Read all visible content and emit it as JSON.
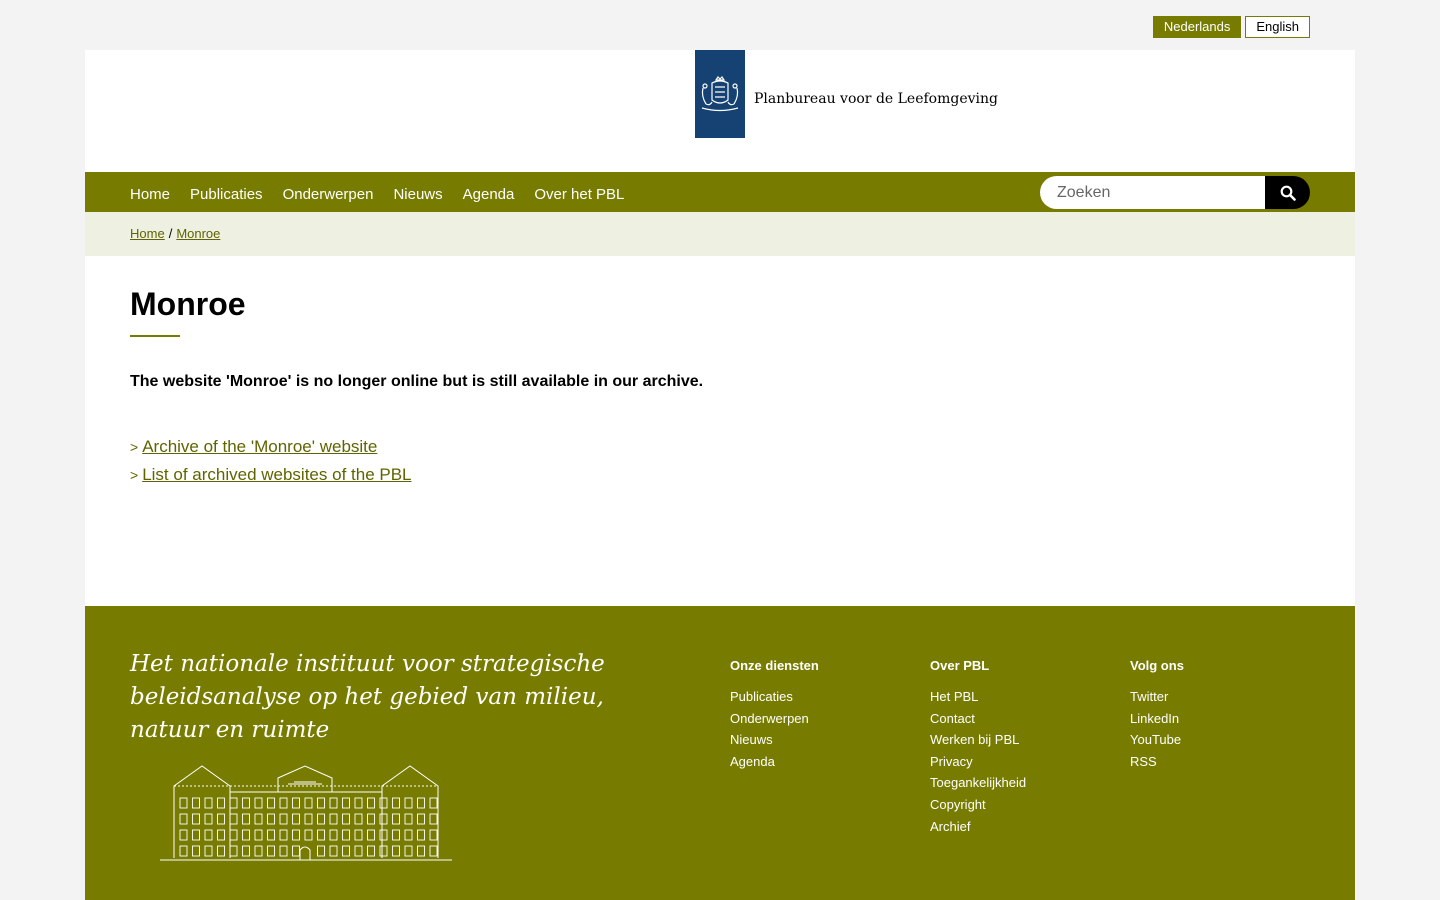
{
  "lang": {
    "nl": "Nederlands",
    "en": "English"
  },
  "header": {
    "org_name": "Planbureau voor de Leefomgeving"
  },
  "nav": {
    "items": [
      {
        "label": "Home"
      },
      {
        "label": "Publicaties"
      },
      {
        "label": "Onderwerpen"
      },
      {
        "label": "Nieuws"
      },
      {
        "label": "Agenda"
      },
      {
        "label": "Over het PBL"
      }
    ],
    "search_placeholder": "Zoeken"
  },
  "breadcrumb": {
    "home": "Home",
    "separator": "/",
    "current": "Monroe"
  },
  "main": {
    "title": "Monroe",
    "notice": "The website 'Monroe' is no longer online but is still available in our archive.",
    "links": [
      {
        "chevron": ">",
        "label": "Archive of the 'Monroe' website"
      },
      {
        "chevron": ">",
        "label": "List of archived websites of the PBL"
      }
    ]
  },
  "footer": {
    "tagline": "Het nationale instituut voor strategische beleidsanalyse op het gebied van milieu, natuur en ruimte",
    "columns": [
      {
        "heading": "Onze diensten",
        "items": [
          "Publicaties",
          "Onderwerpen",
          "Nieuws",
          "Agenda"
        ]
      },
      {
        "heading": "Over PBL",
        "items": [
          "Het PBL",
          "Contact",
          "Werken bij PBL",
          "Privacy",
          "Toegankelijkheid",
          "Copyright",
          "Archief"
        ]
      },
      {
        "heading": "Volg ons",
        "items": [
          "Twitter",
          "LinkedIn",
          "YouTube",
          "RSS"
        ]
      }
    ]
  },
  "colors": {
    "olive": "#777c00",
    "olive_link": "#5f6400",
    "logo_blue": "#154273",
    "breadcrumb_bg": "#eef0e1",
    "outer_bg": "#f3f3f3"
  },
  "icons": {
    "search": "search-icon",
    "coat_of_arms": "coat-of-arms-icon",
    "building": "building-illustration"
  }
}
